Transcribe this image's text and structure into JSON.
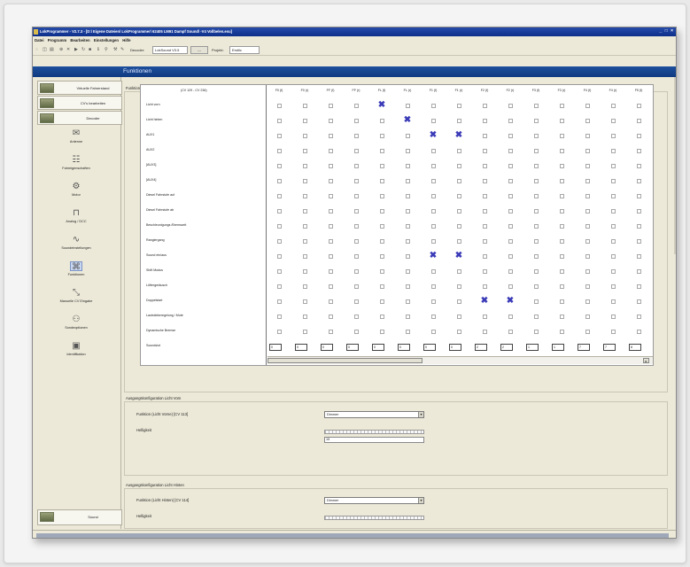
{
  "window": {
    "title": "LokProgrammer - V2.7.3 - [D:\\ Eigene Dateien\\ LokProgrammer\\ 62405 LM91 Dampf Sound\\ -V4 Vollbelen.esu]",
    "controls": "_ □ ×"
  },
  "menu": [
    "Datei",
    "Programm",
    "Bearbeiten",
    "Einstellungen",
    "Hilfe"
  ],
  "toolbar": {
    "decoder_label": "Decoder:",
    "decoder_value": "LokSound V3.5",
    "dash": "---",
    "projekt_label": "Projekt:",
    "projekt_value": "Erstlic"
  },
  "header": {
    "title": "Funktionen"
  },
  "sidebar": {
    "top_buttons": [
      "Virtuelle Fahrerstand",
      "CV's bearbeiten",
      "Decoder"
    ],
    "nav": [
      {
        "label": "Antenne",
        "icon": "envelope-icon"
      },
      {
        "label": "Fahreigenschaften",
        "icon": "sliders-icon"
      },
      {
        "label": "Motor",
        "icon": "motor-icon"
      },
      {
        "label": "Analog / DCC",
        "icon": "analog-icon"
      },
      {
        "label": "Soundeinstellungen",
        "icon": "sound-icon"
      },
      {
        "label": "Funktionen",
        "icon": "functions-icon"
      },
      {
        "label": "Manuelle CV Eingabe",
        "icon": "manual-cv-icon"
      },
      {
        "label": "Sondeoptionen",
        "icon": "options-icon"
      },
      {
        "label": "Identifikation",
        "icon": "identification-icon"
      }
    ],
    "selected_nav": "Funktionen",
    "bottom_button": "Sound"
  },
  "main": {
    "section_mapping": "Funktionszuordnungen",
    "grid": {
      "corner": "(CV 129 - CV 236)",
      "columns": [
        "F0 (f)",
        "F0 (r)",
        "FF (f)",
        "FF (r)",
        "FL (f)",
        "FL (r)",
        "F1 (f)",
        "F1 (r)",
        "F2 (f)",
        "F2 (r)",
        "F3 (f)",
        "F3 (r)",
        "F4 (f)",
        "F4 (r)",
        "F5 (f)"
      ],
      "rows": [
        "Licht vorn",
        "Licht hinten",
        "AUX1",
        "AUX2",
        "[AUX3]",
        "[AUX4]",
        "Diesel Fahrstufe auf",
        "Diesel Fahrstufe ab",
        "Beschleunigungs /Bremszeit",
        "Rangiergang",
        "Sound ein/aus",
        "Shift Modus",
        "Lüftergeräusch",
        "Doppelstart",
        "Lautstärkeregelung / Mute",
        "Dynamische Bremse",
        "Soundslot"
      ],
      "checked": [
        [
          0,
          4
        ],
        [
          1,
          5
        ],
        [
          2,
          6
        ],
        [
          2,
          7
        ],
        [
          10,
          6
        ],
        [
          10,
          7
        ],
        [
          13,
          8
        ],
        [
          13,
          9
        ]
      ],
      "soundslot_values": [
        "0",
        "0",
        "0",
        "0",
        "0",
        "0",
        "0",
        "0",
        "2",
        "2",
        "1",
        "1",
        "7",
        "7",
        "8"
      ]
    },
    "section_front": "Ausgangskonfiguration Licht Vorn",
    "front_function_label": "Funktion (Licht Vorne) [CV 113]",
    "front_function_value": "Dimmer",
    "front_brightness_label": "Helligkeit",
    "front_brightness_value": "15",
    "section_rear": "Ausgangskonfiguration Licht Hinten",
    "rear_function_label": "Funktion (Licht Hinten) [CV 114]",
    "rear_function_value": "Dimmer",
    "rear_brightness_label": "Helligkeit"
  },
  "colors": {
    "accent": "#0f3a80",
    "check": "#3a3ab8"
  }
}
